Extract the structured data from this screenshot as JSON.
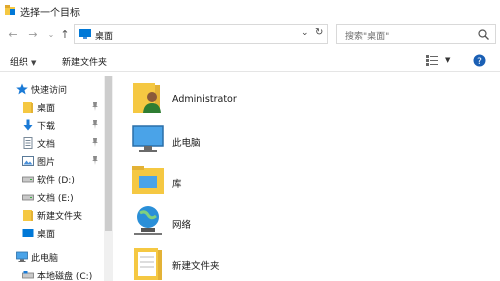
{
  "window": {
    "title": "选择一个目标"
  },
  "addressbar": {
    "path": "桌面"
  },
  "search": {
    "placeholder": "搜索\"桌面\""
  },
  "toolbar": {
    "organize": "组织",
    "new_folder": "新建文件夹"
  },
  "sidebar": {
    "items": [
      {
        "label": "快速访问",
        "icon": "star-icon"
      },
      {
        "label": "桌面",
        "icon": "folder-icon",
        "pinned": true
      },
      {
        "label": "下载",
        "icon": "download-icon",
        "pinned": true
      },
      {
        "label": "文档",
        "icon": "document-icon",
        "pinned": true
      },
      {
        "label": "图片",
        "icon": "picture-icon",
        "pinned": true
      },
      {
        "label": "软件 (D:)",
        "icon": "drive-icon"
      },
      {
        "label": "文档 (E:)",
        "icon": "drive-icon"
      },
      {
        "label": "新建文件夹",
        "icon": "folder-icon"
      },
      {
        "label": "桌面",
        "icon": "desktop-icon"
      },
      {
        "label": "此电脑",
        "icon": "computer-icon"
      },
      {
        "label": "本地磁盘 (C:)",
        "icon": "drive-icon"
      }
    ]
  },
  "content": {
    "items": [
      {
        "label": "Administrator",
        "icon": "user-folder-icon"
      },
      {
        "label": "此电脑",
        "icon": "computer-icon"
      },
      {
        "label": "库",
        "icon": "library-icon"
      },
      {
        "label": "网络",
        "icon": "network-icon"
      },
      {
        "label": "新建文件夹",
        "icon": "folder-icon"
      }
    ]
  },
  "colors": {
    "accent": "#0078d7",
    "folder": "#f5c842",
    "scroll_thumb": "#cdcdcd"
  }
}
